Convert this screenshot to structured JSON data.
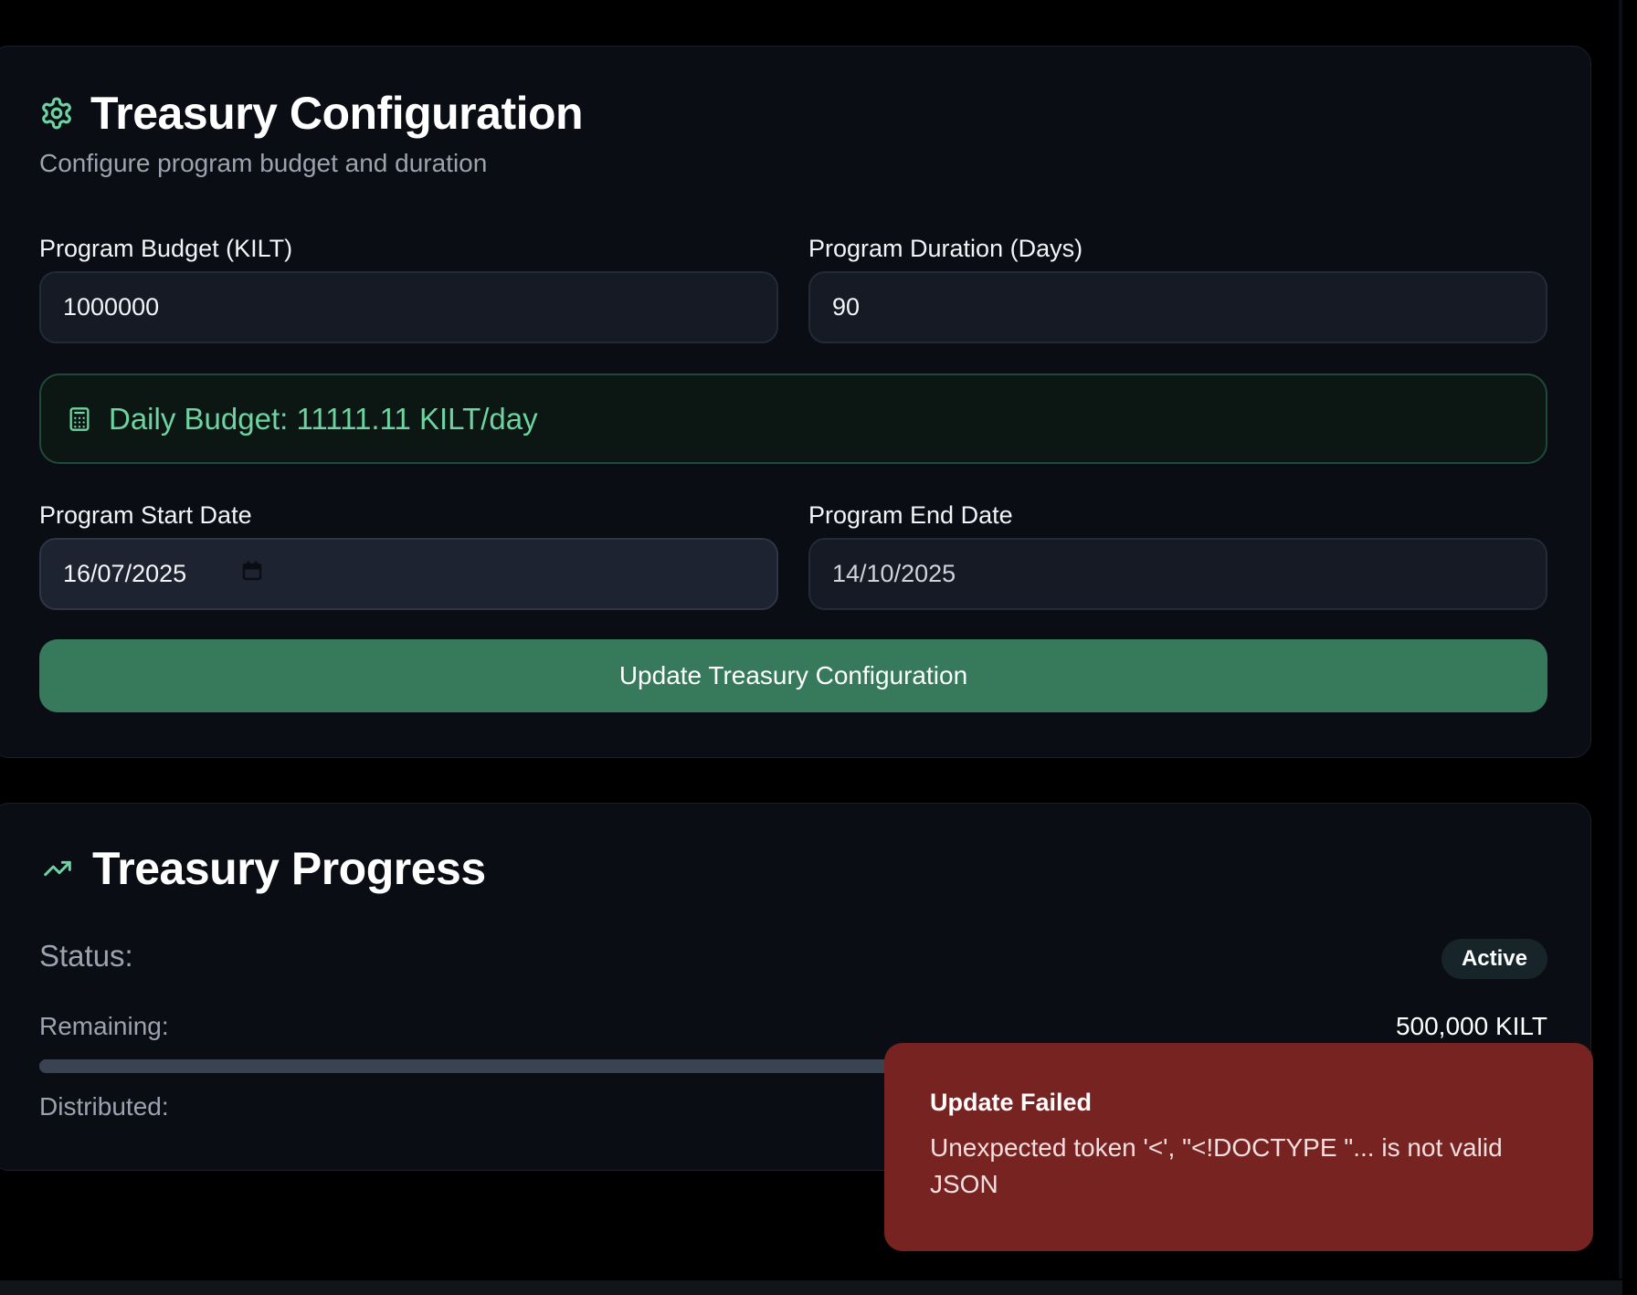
{
  "config": {
    "title": "Treasury Configuration",
    "subtitle": "Configure program budget and duration",
    "budget_label": "Program Budget (KILT)",
    "budget_value": "1000000",
    "duration_label": "Program Duration (Days)",
    "duration_value": "90",
    "daily_budget": "Daily Budget: 11111.11 KILT/day",
    "start_label": "Program Start Date",
    "start_value": "16/07/2025",
    "end_label": "Program End Date",
    "end_value": "14/10/2025",
    "update_button": "Update Treasury Configuration"
  },
  "progress": {
    "title": "Treasury Progress",
    "status_label": "Status:",
    "status_value": "Active",
    "remaining_label": "Remaining:",
    "remaining_value": "500,000 KILT",
    "distributed_label": "Distributed:",
    "distributed_fraction": 0.5
  },
  "toast": {
    "title": "Update Failed",
    "message": "Unexpected token '<', \"<!DOCTYPE \"... is not valid JSON"
  },
  "colors": {
    "accent_green": "#6cd3a1",
    "button_green": "#367a5b",
    "error_red": "#762322",
    "card_bg": "#0a0d14"
  }
}
